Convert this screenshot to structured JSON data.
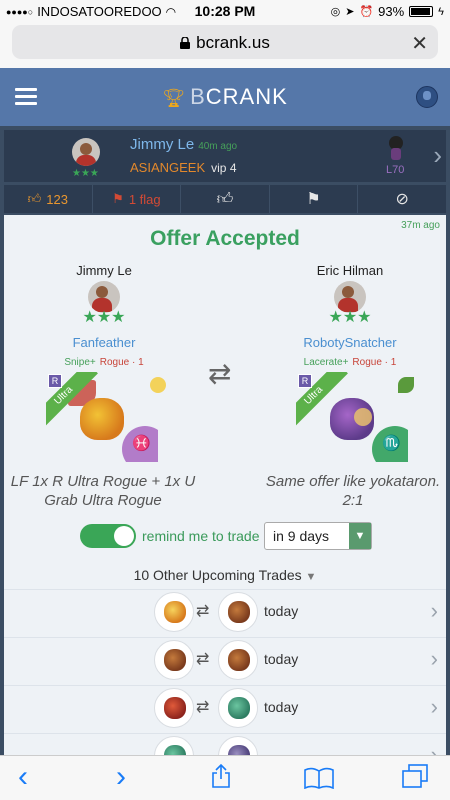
{
  "status_bar": {
    "carrier": "INDOSATOOREDOO",
    "time": "10:28 PM",
    "battery": "93%"
  },
  "browser": {
    "url": "bcrank.us"
  },
  "site": {
    "logo_b": "B",
    "logo_rest": "CRANK"
  },
  "post": {
    "user_name": "Jimmy Le",
    "time_ago": "40m ago",
    "team": "ASIANGEEK",
    "vip": "vip 4",
    "level": "L70",
    "stars": "★★★",
    "likes": "123",
    "flags": "1 flag"
  },
  "offer": {
    "time_ago": "37m ago",
    "title": "Offer Accepted",
    "left": {
      "trader": "Jimmy Le",
      "stars": "★★★",
      "pet": "Fanfeather",
      "skill": "Snipe+",
      "role": "Rogue · 1",
      "rarity": "Ultra",
      "badge": "R",
      "zodiac": "♓",
      "description": "LF 1x R Ultra Rogue + 1x U Grab Ultra Rogue"
    },
    "right": {
      "trader": "Eric Hilman",
      "stars": "★★★",
      "pet": "RobotySnatcher",
      "skill": "Lacerate+",
      "role": "Rogue · 1",
      "rarity": "Ultra",
      "badge": "R",
      "zodiac": "♏",
      "description": "Same offer like yokataron. 2:1"
    }
  },
  "remind": {
    "label": "remind me to trade",
    "selected": "in 9 days"
  },
  "upcoming": {
    "title": "10 Other Upcoming Trades",
    "rows": [
      {
        "when": "today"
      },
      {
        "when": "today"
      },
      {
        "when": "today"
      },
      {
        "when": ""
      }
    ]
  },
  "colors": {
    "header": "#5577a9",
    "accent_green": "#3aa657",
    "link_blue": "#4a8fd0",
    "safari_blue": "#1a7cf7"
  }
}
